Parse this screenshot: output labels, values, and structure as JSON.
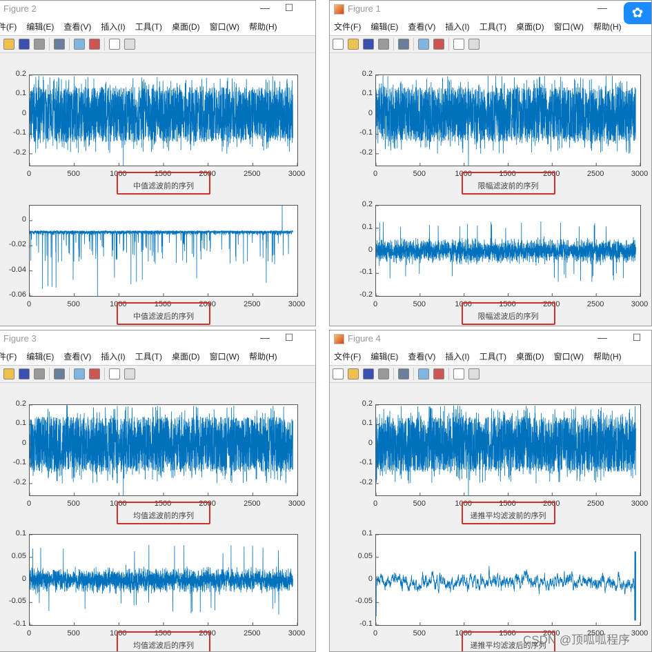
{
  "menu": [
    "文件(F)",
    "编辑(E)",
    "查看(V)",
    "插入(I)",
    "工具(T)",
    "桌面(D)",
    "窗口(W)",
    "帮助(H)"
  ],
  "toolbar_icons": [
    "new-file-icon",
    "open-folder-icon",
    "save-icon",
    "print-icon",
    "print-preview-icon",
    "colorbar-icon",
    "legend-icon",
    "pointer-icon",
    "property-editor-icon"
  ],
  "window_controls": {
    "minimize": "—",
    "maximize": "☐",
    "close": "✕"
  },
  "watermark": "CSDN @顶呱呱程序",
  "line_color": "#0072bd",
  "highlight_color": "#d0302a",
  "windows": [
    {
      "title": "Figure 2",
      "pos": "top-left",
      "plots": [
        {
          "xlabel": "中值滤波前的序列",
          "kind": "raw"
        },
        {
          "xlabel": "中值滤波后的序列",
          "kind": "median"
        }
      ]
    },
    {
      "title": "Figure 1",
      "pos": "top-right",
      "plots": [
        {
          "xlabel": "限幅滤波前的序列",
          "kind": "raw"
        },
        {
          "xlabel": "限幅滤波后的序列",
          "kind": "limit"
        }
      ]
    },
    {
      "title": "Figure 3",
      "pos": "bottom-left",
      "plots": [
        {
          "xlabel": "均值滤波前的序列",
          "kind": "raw"
        },
        {
          "xlabel": "均值滤波后的序列",
          "kind": "mean"
        }
      ]
    },
    {
      "title": "Figure 4",
      "pos": "bottom-right",
      "plots": [
        {
          "xlabel": "递推平均滤波前的序列",
          "kind": "raw"
        },
        {
          "xlabel": "递推平均滤波后的序列",
          "kind": "recursive"
        }
      ]
    }
  ],
  "chart_data": [
    {
      "type": "line",
      "id": "raw",
      "xlim": [
        0,
        3000
      ],
      "xticks": [
        "0",
        "500",
        "1000",
        "1500",
        "2000",
        "2500",
        "3000"
      ],
      "ylim": [
        -0.26,
        0.2
      ],
      "yticks": [
        "-0.2",
        "-0.1",
        "0",
        "0.1",
        "0.2"
      ],
      "ytick_values": [
        -0.2,
        -0.1,
        0,
        0.1,
        0.2
      ],
      "x_end": 2950,
      "y_range_observed": [
        -0.26,
        0.2
      ],
      "grid": false
    },
    {
      "type": "line",
      "id": "median",
      "xlim": [
        0,
        3000
      ],
      "xticks": [
        "0",
        "500",
        "1000",
        "1500",
        "2000",
        "2500",
        "3000"
      ],
      "ylim": [
        -0.06,
        0.012
      ],
      "yticks": [
        "-0.06",
        "-0.04",
        "-0.02",
        "0"
      ],
      "ytick_values": [
        -0.06,
        -0.04,
        -0.02,
        0
      ],
      "x_end": 2950,
      "y_range_observed": [
        -0.06,
        0.012
      ],
      "grid": false
    },
    {
      "type": "line",
      "id": "limit",
      "xlim": [
        0,
        3000
      ],
      "xticks": [
        "0",
        "500",
        "1000",
        "1500",
        "2000",
        "2500",
        "3000"
      ],
      "ylim": [
        -0.2,
        0.2
      ],
      "yticks": [
        "-0.2",
        "-0.1",
        "0",
        "0.1",
        "0.2"
      ],
      "ytick_values": [
        -0.2,
        -0.1,
        0,
        0.1,
        0.2
      ],
      "x_end": 2950,
      "y_range_observed": [
        -0.14,
        0.15
      ],
      "grid": false
    },
    {
      "type": "line",
      "id": "mean",
      "xlim": [
        0,
        3000
      ],
      "xticks": [
        "0",
        "500",
        "1000",
        "1500",
        "2000",
        "2500",
        "3000"
      ],
      "ylim": [
        -0.1,
        0.1
      ],
      "yticks": [
        "-0.1",
        "-0.05",
        "0",
        "0.05",
        "0.1"
      ],
      "ytick_values": [
        -0.1,
        -0.05,
        0,
        0.05,
        0.1
      ],
      "x_end": 2950,
      "y_range_observed": [
        -0.09,
        0.07
      ],
      "grid": false
    },
    {
      "type": "line",
      "id": "recursive",
      "xlim": [
        0,
        3000
      ],
      "xticks": [
        "0",
        "500",
        "1000",
        "1500",
        "2000",
        "2500",
        "3000"
      ],
      "ylim": [
        -0.1,
        0.1
      ],
      "yticks": [
        "-0.1",
        "-0.05",
        "0",
        "0.05",
        "0.1"
      ],
      "ytick_values": [
        -0.1,
        -0.05,
        0,
        0.05,
        0.1
      ],
      "x_end": 2950,
      "y_range_observed": [
        -0.09,
        0.065
      ],
      "grid": false
    }
  ]
}
